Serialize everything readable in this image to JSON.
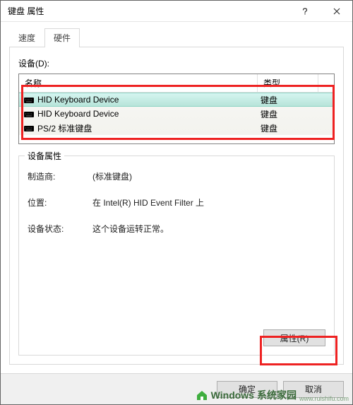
{
  "window": {
    "title": "键盘 属性"
  },
  "tabs": {
    "items": [
      {
        "label": "速度"
      },
      {
        "label": "硬件"
      }
    ],
    "active": 1
  },
  "devices": {
    "label": "设备(D):",
    "columns": {
      "name": "名称",
      "type": "类型"
    },
    "rows": [
      {
        "name": "HID Keyboard Device",
        "type": "键盘",
        "selected": true
      },
      {
        "name": "HID Keyboard Device",
        "type": "键盘",
        "selected": false
      },
      {
        "name": "PS/2 标准键盘",
        "type": "键盘",
        "selected": false
      }
    ]
  },
  "properties": {
    "legend": "设备属性",
    "manufacturer_label": "制造商:",
    "manufacturer_value": "(标准键盘)",
    "location_label": "位置:",
    "location_value": "在 Intel(R) HID Event Filter 上",
    "status_label": "设备状态:",
    "status_value": "这个设备运转正常。",
    "button_label": "属性(R)"
  },
  "footer": {
    "ok_label": "确定",
    "cancel_label": "取消"
  },
  "watermark": {
    "brand_big": "Windows",
    "brand_cn": "系统家园",
    "url": "www.ruishifu.com"
  }
}
